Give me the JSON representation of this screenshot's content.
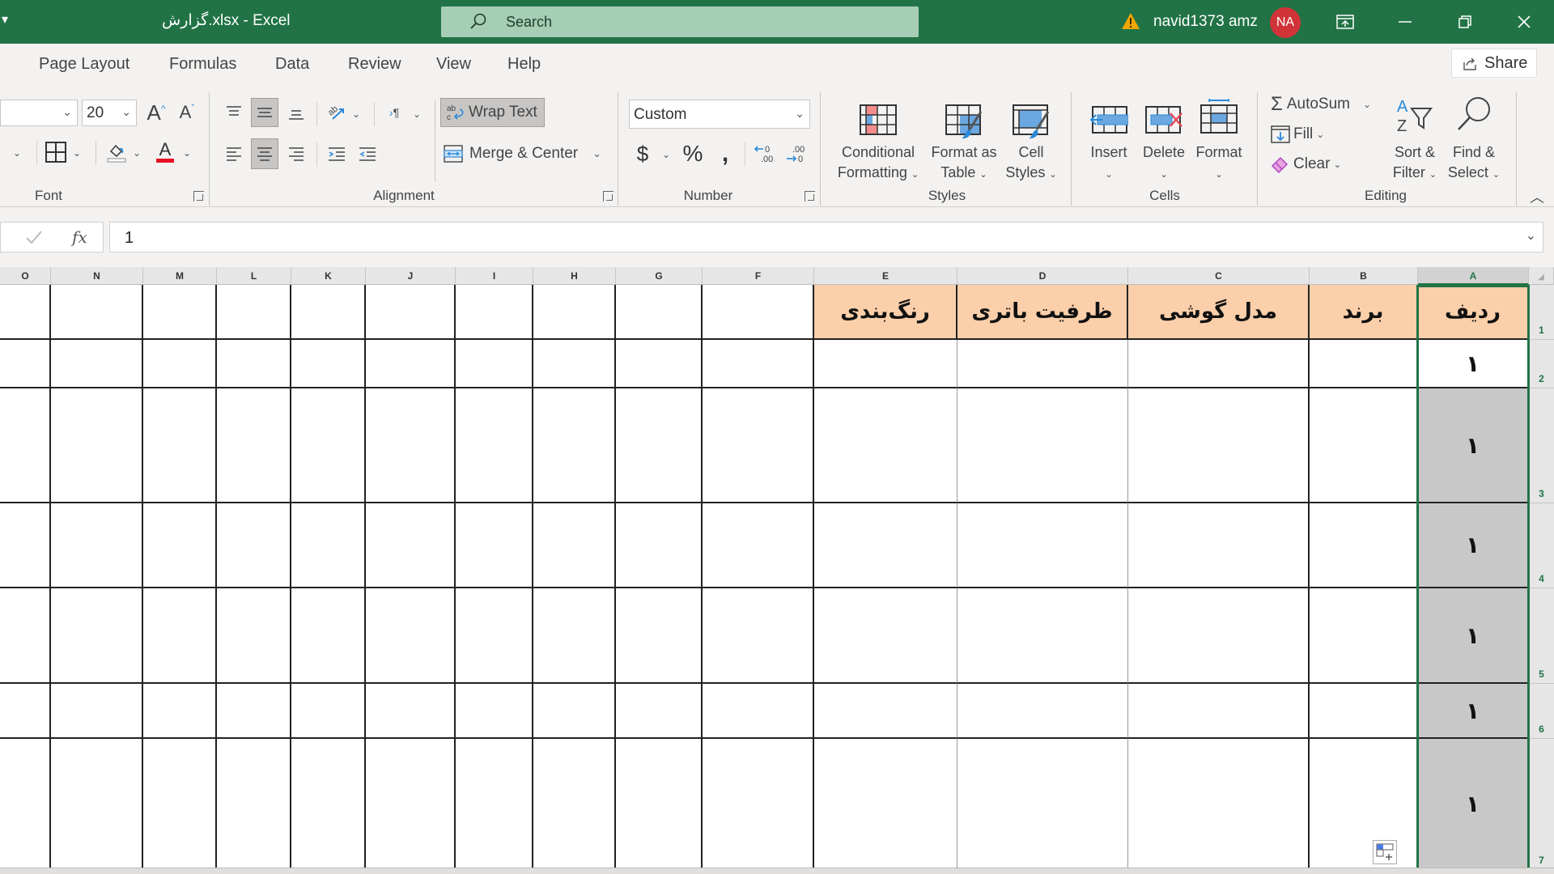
{
  "titlebar": {
    "title": "گزارش.xlsx  -  Excel",
    "search_placeholder": "Search",
    "username": "navid1373 amz",
    "avatar_initials": "NA",
    "icons": [
      "warning-icon",
      "ribbon-display-icon",
      "minimize-icon",
      "restore-icon",
      "close-icon"
    ]
  },
  "tabs": [
    "Page Layout",
    "Formulas",
    "Data",
    "Review",
    "View",
    "Help"
  ],
  "share_label": "Share",
  "ribbon": {
    "font": {
      "label": "Font",
      "font_name": "",
      "font_size": "20",
      "font_color": "#e81123"
    },
    "alignment": {
      "label": "Alignment",
      "wrap_text": "Wrap Text",
      "merge_center": "Merge & Center"
    },
    "number": {
      "label": "Number",
      "format": "Custom"
    },
    "styles": {
      "label": "Styles",
      "conditional_formatting": [
        "Conditional",
        "Formatting"
      ],
      "format_as_table": [
        "Format as",
        "Table"
      ],
      "cell_styles": [
        "Cell",
        "Styles"
      ]
    },
    "cells": {
      "label": "Cells",
      "insert": "Insert",
      "delete": "Delete",
      "format": "Format"
    },
    "editing": {
      "label": "Editing",
      "autosum": "AutoSum",
      "fill": "Fill",
      "clear": "Clear",
      "sort_filter": [
        "Sort &",
        "Filter"
      ],
      "find_select": [
        "Find &",
        "Select"
      ]
    }
  },
  "formula_bar": {
    "value": "1",
    "fx_label": "fx"
  },
  "sheet": {
    "columns": [
      "O",
      "N",
      "M",
      "L",
      "K",
      "J",
      "I",
      "H",
      "G",
      "F",
      "E",
      "D",
      "C",
      "B",
      "A"
    ],
    "selected_column": "A",
    "rows": [
      "1",
      "2",
      "3",
      "4",
      "5",
      "6",
      "7"
    ],
    "header_row": {
      "A": "ردیف",
      "B": "برند",
      "C": "مدل گوشی",
      "D": "ظرفیت باتری",
      "E": "رنگ‌بندی"
    },
    "column_a_values": [
      "١",
      "١",
      "١",
      "١",
      "١",
      "١"
    ],
    "header_fill_color": "#fbcfaa",
    "selection_color": "#217346"
  }
}
